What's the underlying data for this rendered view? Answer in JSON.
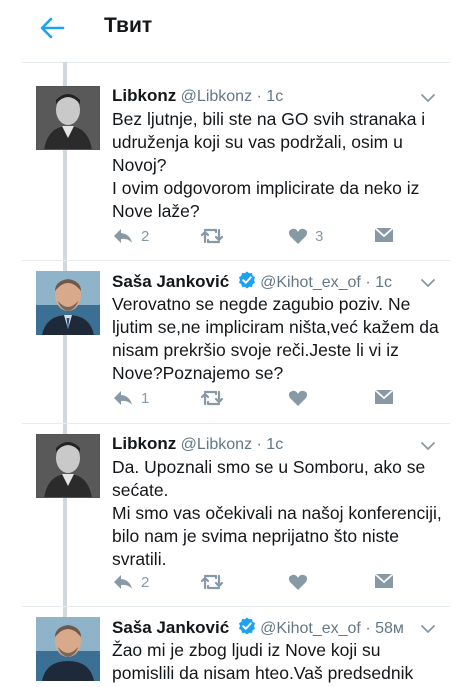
{
  "header": {
    "title": "Твит"
  },
  "tweets": [
    {
      "name": "Libkonz",
      "handle": "@Libkonz",
      "time": "1c",
      "verified": false,
      "paragraphs": [
        "Bez ljutnje, bili ste na GO svih stranaka i udruženja koji su vas podržali, osim u Novoj?",
        "I ovim odgovorom implicirate da neko iz Nove laže?"
      ],
      "replies": "2",
      "retweets": "",
      "likes": "3"
    },
    {
      "name": "Saša Janković",
      "handle": "@Kihot_ex_of",
      "time": "1c",
      "verified": true,
      "paragraphs": [
        "Verovatno se negde zagubio poziv. Ne ljutim se,ne impliciram ništa,već kažem da nisam prekršio svoje reči.Jeste li vi iz Nove?Poznajemo se?"
      ],
      "replies": "1",
      "retweets": "",
      "likes": ""
    },
    {
      "name": "Libkonz",
      "handle": "@Libkonz",
      "time": "1c",
      "verified": false,
      "paragraphs": [
        "Da. Upoznali smo se u Somboru, ako se sećate.",
        "Mi smo vas očekivali na našoj konferenciji, bilo nam je svima neprijatno što niste svratili."
      ],
      "replies": "2",
      "retweets": "",
      "likes": ""
    },
    {
      "name": "Saša Janković",
      "handle": "@Kihot_ex_of",
      "time": "58м",
      "verified": true,
      "paragraphs": [
        "Žao mi je zbog ljudi iz Nove koji su pomislili da nisam hteo.Vaš predsednik"
      ],
      "replies": "",
      "retweets": "",
      "likes": ""
    }
  ],
  "colors": {
    "accent": "#1da1f2",
    "icon": "#8899a6",
    "handle": "#657786"
  },
  "icons": [
    "back-arrow-icon",
    "chevron-down-icon",
    "verified-badge-icon",
    "reply-icon",
    "retweet-icon",
    "like-icon",
    "message-icon"
  ]
}
